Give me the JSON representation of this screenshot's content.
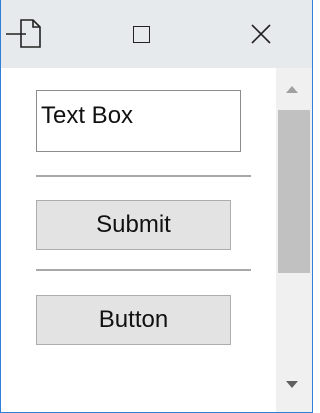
{
  "titlebar": {
    "pin_icon": "pin-window-icon",
    "maximize_icon": "maximize-icon",
    "close_icon": "close-icon"
  },
  "form": {
    "textbox_value": "Text Box",
    "submit_label": "Submit",
    "button_label": "Button"
  },
  "scrollbar": {
    "up_icon": "scroll-up-arrow-icon",
    "down_icon": "scroll-down-arrow-icon"
  },
  "colors": {
    "window_border": "#2f7fd6",
    "titlebar_bg": "#e7eaed",
    "button_bg": "#e3e3e3",
    "scroll_thumb": "#c1c1c1"
  }
}
